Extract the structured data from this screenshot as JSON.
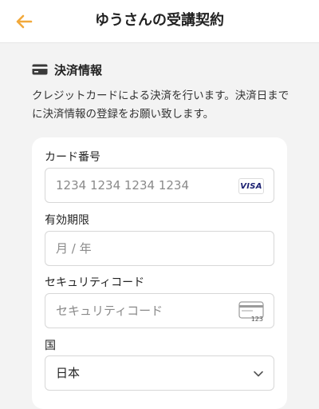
{
  "header": {
    "title": "ゆうさんの受講契約",
    "accent_color": "#f2a93b"
  },
  "payment": {
    "section_title": "決済情報",
    "description": "クレジットカードによる決済を行います。決済日までに決済情報の登録をお願い致します。",
    "card_number": {
      "label": "カード番号",
      "placeholder": "1234 1234 1234 1234",
      "brand_badge": "VISA"
    },
    "expiry": {
      "label": "有効期限",
      "placeholder": "月 / 年"
    },
    "security_code": {
      "label": "セキュリティコード",
      "placeholder": "セキュリティコード",
      "icon_text": "123"
    },
    "country": {
      "label": "国",
      "value": "日本"
    }
  }
}
